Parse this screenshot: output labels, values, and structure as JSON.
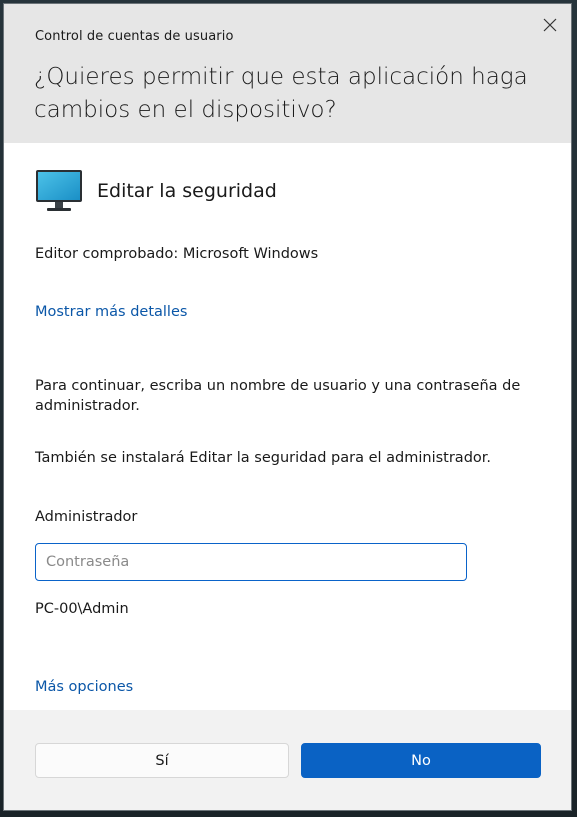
{
  "dialog": {
    "title": "Control de cuentas de usuario",
    "question": "¿Quieres permitir que esta aplicación haga cambios en el dispositivo?",
    "close_icon": "close-icon"
  },
  "app": {
    "icon": "monitor-icon",
    "name": "Editar la seguridad",
    "publisher": "Editor comprobado: Microsoft Windows",
    "details_link": "Mostrar más detalles"
  },
  "credentials": {
    "instructions": "Para continuar, escriba un nombre de usuario y una contraseña de administrador.",
    "also_install": "También se instalará Editar la seguridad para el administrador.",
    "user_label": "Administrador",
    "password_value": "",
    "password_placeholder": "Contraseña",
    "domain_user": "PC-00\\Admin",
    "more_options": "Más opciones"
  },
  "buttons": {
    "yes": "Sí",
    "no": "No"
  },
  "colors": {
    "accent": "#0a62c4",
    "link": "#0b57a8",
    "header_bg": "#e6e6e6",
    "footer_bg": "#f2f2f2"
  }
}
